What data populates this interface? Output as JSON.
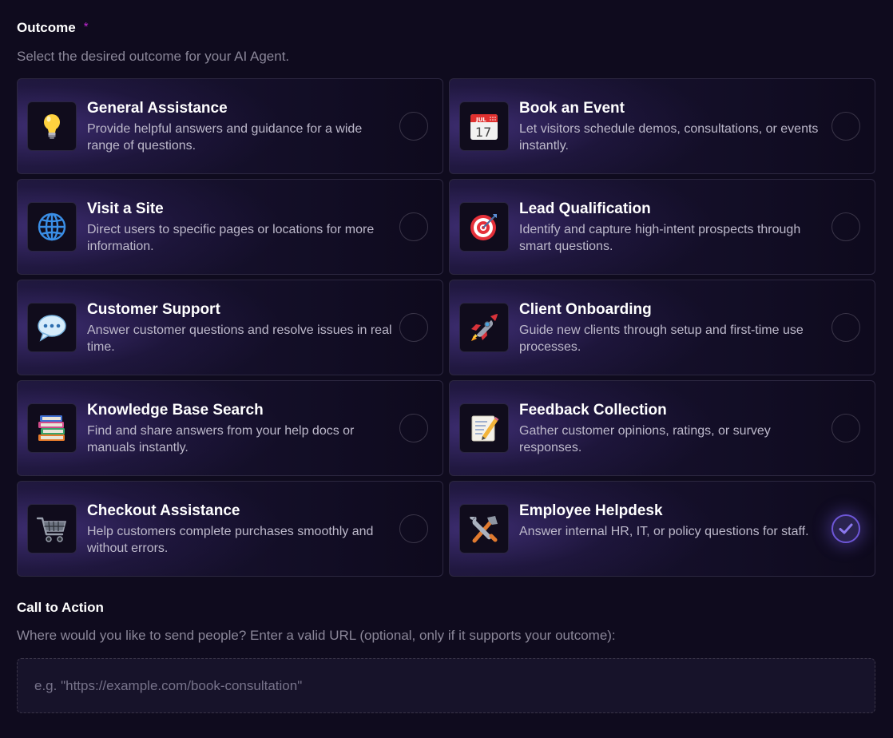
{
  "outcome": {
    "label": "Outcome",
    "required_mark": "*",
    "hint": "Select the desired outcome for your AI Agent.",
    "selected": "Employee Helpdesk",
    "options": [
      {
        "title": "General Assistance",
        "description": "Provide helpful answers and guidance for a wide range of questions.",
        "icon": "lightbulb-icon"
      },
      {
        "title": "Book an Event",
        "description": "Let visitors schedule demos, consultations, or events instantly.",
        "icon": "calendar-icon",
        "icon_text": {
          "month": "JUL",
          "day": "17"
        }
      },
      {
        "title": "Visit a Site",
        "description": "Direct users to specific pages or locations for more information.",
        "icon": "globe-icon"
      },
      {
        "title": "Lead Qualification",
        "description": "Identify and capture high-intent prospects through smart questions.",
        "icon": "target-icon"
      },
      {
        "title": "Customer Support",
        "description": "Answer customer questions and resolve issues in real time.",
        "icon": "speech-bubble-icon"
      },
      {
        "title": "Client Onboarding",
        "description": "Guide new clients through setup and first-time use processes.",
        "icon": "rocket-icon"
      },
      {
        "title": "Knowledge Base Search",
        "description": "Find and share answers from your help docs or manuals instantly.",
        "icon": "books-icon"
      },
      {
        "title": "Feedback Collection",
        "description": "Gather customer opinions, ratings, or survey responses.",
        "icon": "memo-icon"
      },
      {
        "title": "Checkout Assistance",
        "description": "Help customers complete purchases smoothly and without errors.",
        "icon": "shopping-cart-icon"
      },
      {
        "title": "Employee Helpdesk",
        "description": "Answer internal HR, IT, or policy questions for staff.",
        "icon": "tools-icon"
      }
    ]
  },
  "call_to_action": {
    "label": "Call to Action",
    "hint": "Where would you like to send people? Enter a valid URL (optional, only if it supports your outcome):",
    "value": "",
    "placeholder": "e.g. \"https://example.com/book-consultation\""
  },
  "colors": {
    "background": "#0f0b1e",
    "accent": "#6d56d6",
    "required": "#c026d3",
    "muted_text": "#8a8698"
  }
}
